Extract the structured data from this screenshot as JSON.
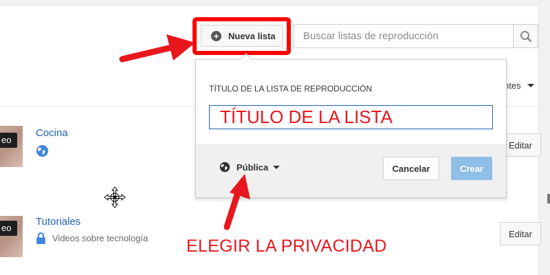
{
  "toolbar": {
    "new_list_label": "Nueva lista",
    "search_placeholder": "Buscar listas de reproducción"
  },
  "sort": {
    "label_partial": "ntes"
  },
  "playlists": [
    {
      "title": "Cocina",
      "thumb_badge": "eo",
      "privacy_icon": "globe-icon",
      "description": "",
      "edit_label": "Editar"
    },
    {
      "title": "Tutoriales",
      "thumb_badge": "eo",
      "privacy_icon": "lock-icon",
      "description": "Videos sobre tecnología",
      "edit_label": "Editar"
    }
  ],
  "dialog": {
    "heading": "TÍTULO DE LA LISTA DE REPRODUCCIÓN",
    "title_value": "TÍTULO DE LA LISTA",
    "privacy_label": "Pública",
    "cancel_label": "Cancelar",
    "create_label": "Crear"
  },
  "annotation": {
    "text": "ELEGIR LA PRIVACIDAD"
  },
  "colors": {
    "annotation_red": "#e8171e",
    "link_blue": "#1e62b5",
    "create_disabled": "#8fbee6"
  }
}
